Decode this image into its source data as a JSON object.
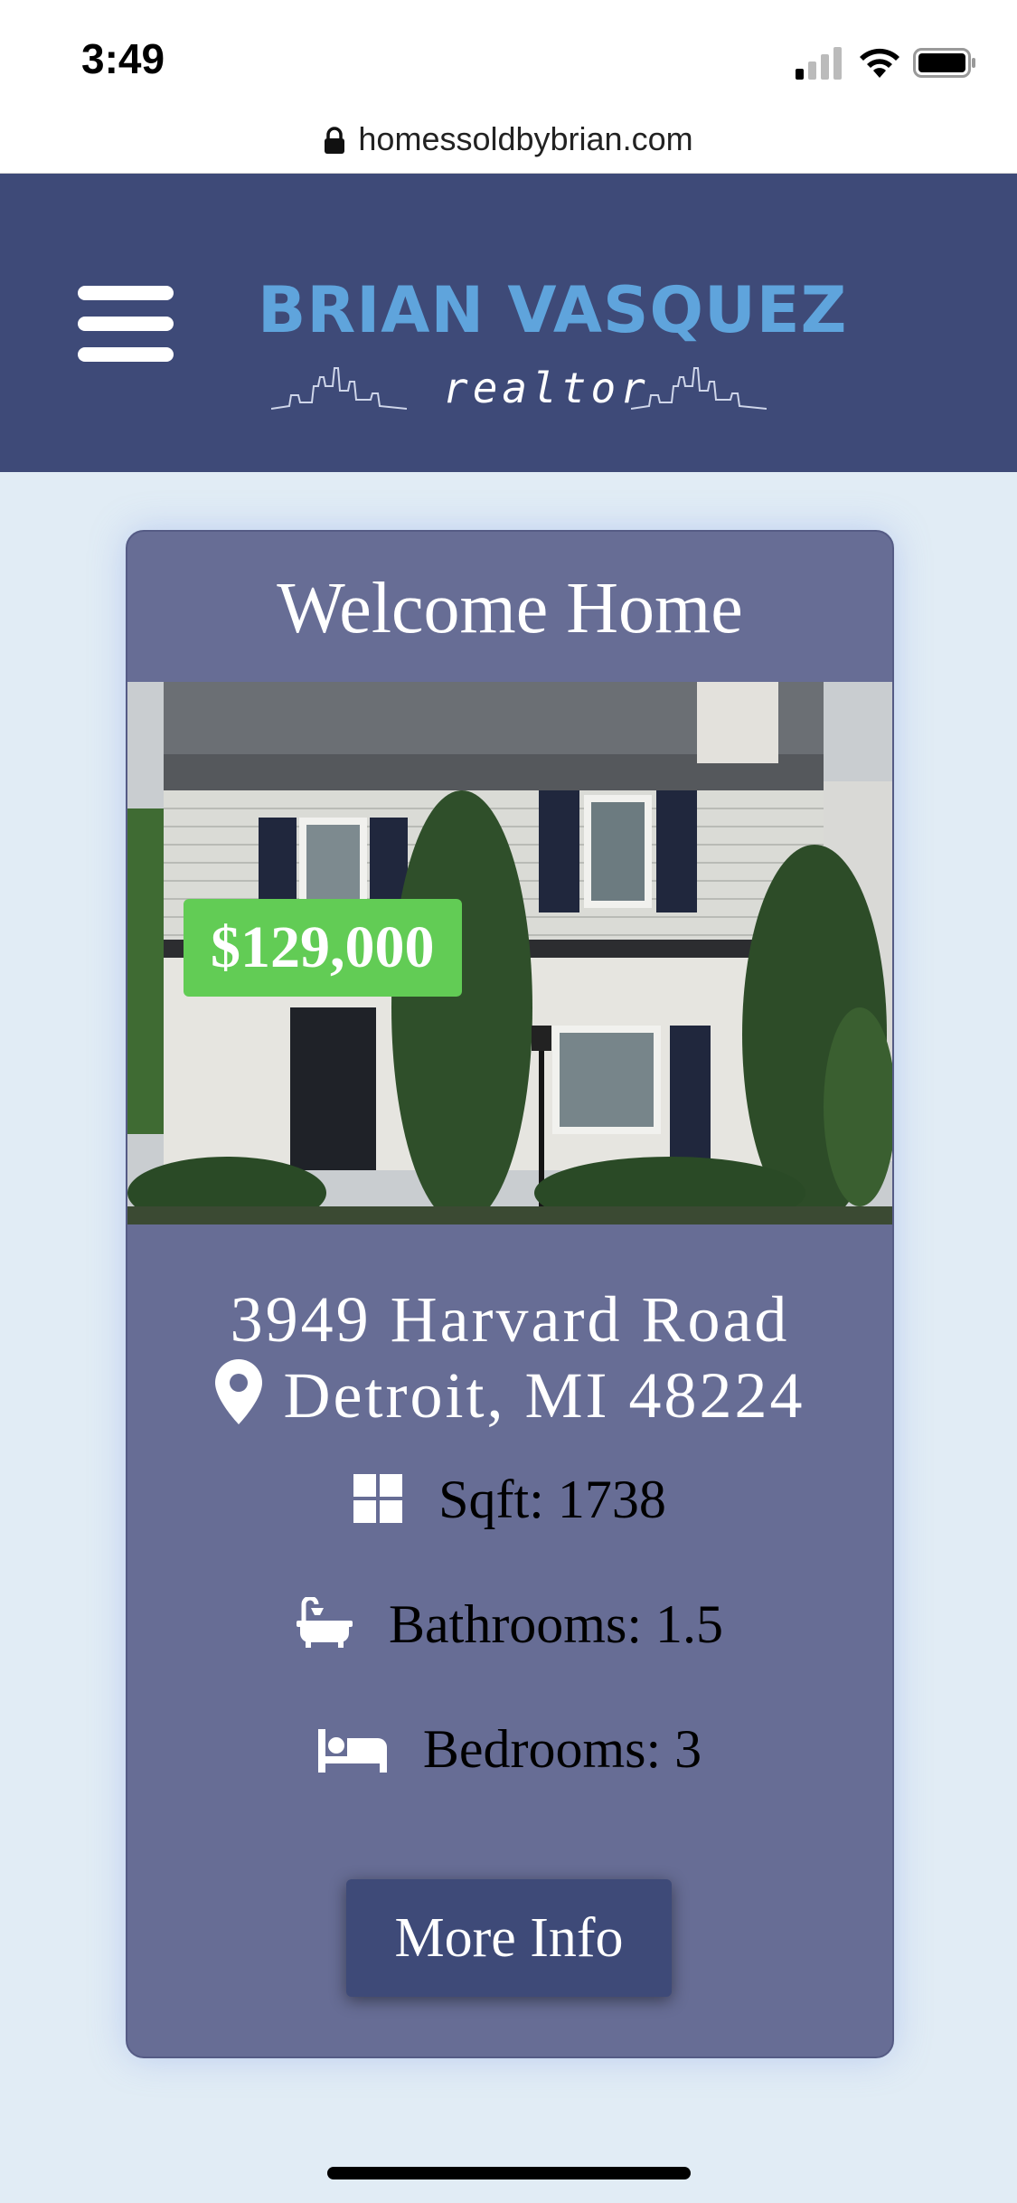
{
  "status": {
    "time": "3:49"
  },
  "browser": {
    "url": "homessoldbybrian.com"
  },
  "header": {
    "brand": "BRIAN VASQUEZ",
    "tagline": "realtor"
  },
  "card": {
    "title": "Welcome Home",
    "price": "$129,000",
    "address_line1": "3949 Harvard Road",
    "address_line2": "Detroit, MI 48224",
    "house_number": "3949",
    "sqft": "Sqft: 1738",
    "bathrooms": "Bathrooms: 1.5",
    "bedrooms": "Bedrooms: 3",
    "button_label": "More Info"
  },
  "icons": {
    "menu": "hamburger-icon",
    "lock": "lock-icon",
    "location": "map-pin-icon",
    "sqft": "grid-icon",
    "bath": "bathtub-icon",
    "bed": "bed-icon"
  },
  "colors": {
    "header_bg": "#3e4a78",
    "brand": "#5fa4dc",
    "card_bg": "#676d95",
    "price_badge": "#62cc55",
    "page_bg": "#e1ecf5"
  }
}
